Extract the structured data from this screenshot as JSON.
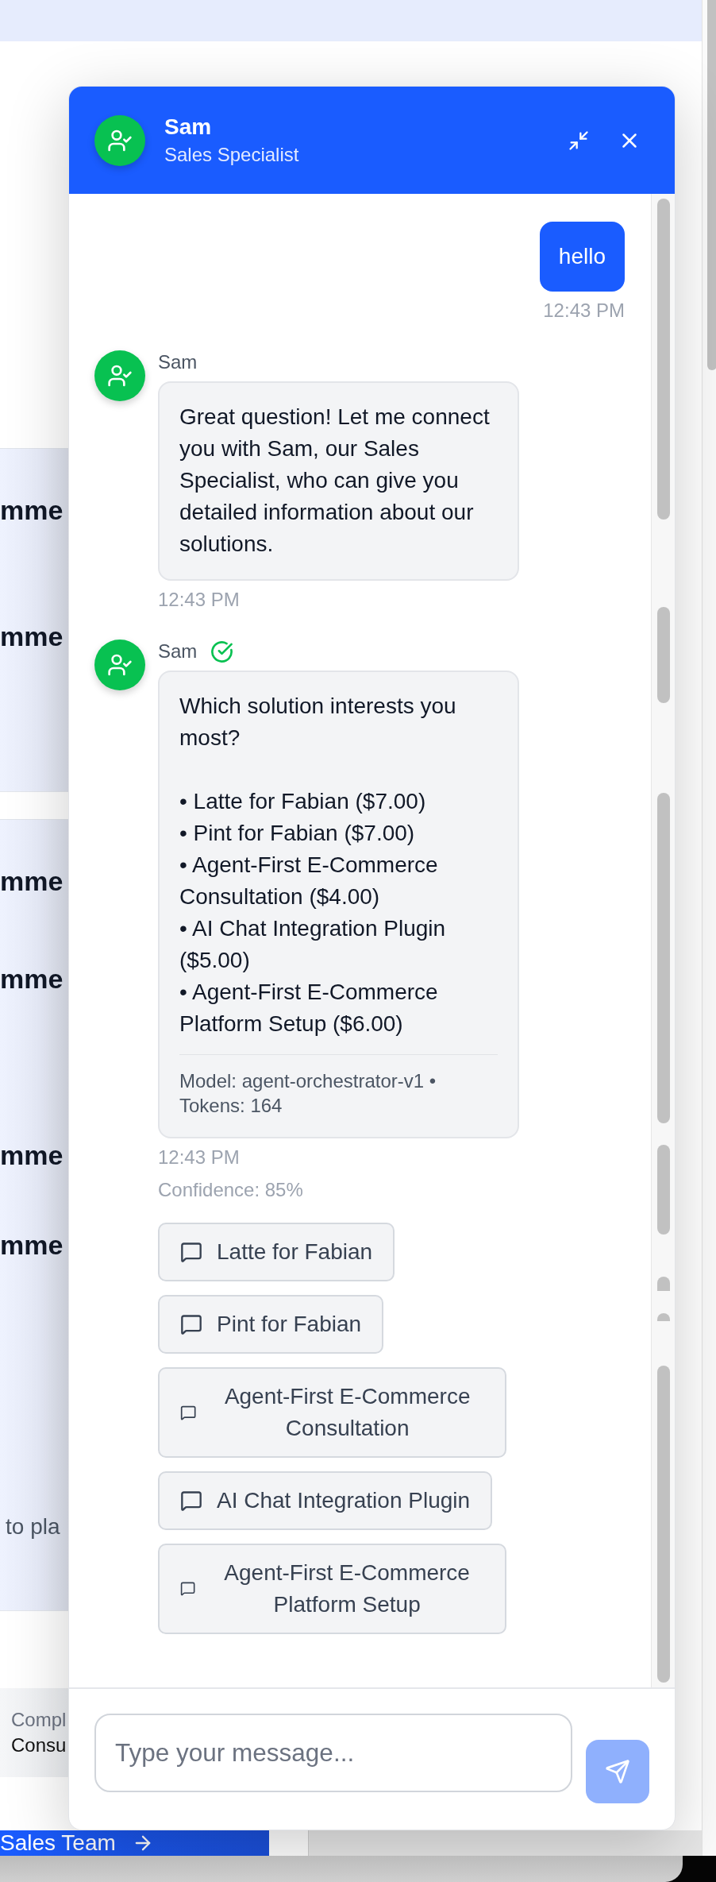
{
  "page": {
    "panels": [
      {
        "items": [
          {
            "kind": "heading",
            "text": "mme"
          },
          {
            "kind": "heading",
            "text": "mme"
          }
        ]
      },
      {
        "items": [
          {
            "kind": "heading",
            "text": "mme"
          },
          {
            "kind": "heading",
            "text": "mme"
          },
          {
            "kind": "heading",
            "text": "mme"
          },
          {
            "kind": "heading",
            "text": "mme"
          },
          {
            "kind": "text",
            "text": "to pla"
          }
        ]
      }
    ],
    "card": {
      "label": "Compl",
      "value": "Consu"
    },
    "cta_button": {
      "label": "Sales Team"
    }
  },
  "chat": {
    "header": {
      "name": "Sam",
      "role": "Sales Specialist"
    },
    "messages": [
      {
        "kind": "user",
        "text": "hello",
        "time": "12:43 PM"
      },
      {
        "kind": "agent",
        "name": "Sam",
        "verified": false,
        "text": "Great question! Let me connect you with Sam, our Sales Specialist, who can give you detailed information about our solutions.",
        "time": "12:43 PM"
      },
      {
        "kind": "agent",
        "name": "Sam",
        "verified": true,
        "text": "Which solution interests you most?\n\n• Latte for Fabian ($7.00)\n• Pint for Fabian ($7.00)\n• Agent-First E-Commerce Consultation ($4.00)\n• AI Chat Integration Plugin ($5.00)\n• Agent-First E-Commerce Platform Setup ($6.00)",
        "meta": "Model: agent-orchestrator-v1 • Tokens: 164",
        "time": "12:43 PM",
        "confidence": "Confidence: 85%",
        "quick_replies": [
          "Latte for Fabian",
          "Pint for Fabian",
          "Agent-First E-Commerce Consultation",
          "AI Chat Integration Plugin",
          "Agent-First E-Commerce Platform Setup"
        ]
      }
    ],
    "input": {
      "placeholder": "Type your message..."
    },
    "send_button": {
      "disabled": true
    }
  }
}
